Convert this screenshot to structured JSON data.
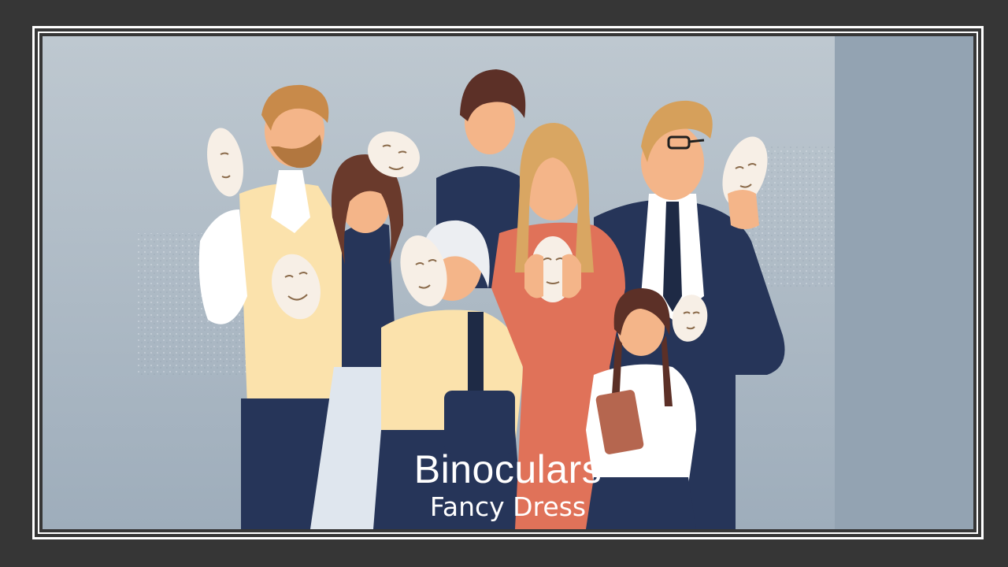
{
  "caption": {
    "title": "Binoculars",
    "subtitle": "Fancy Dress"
  },
  "colors": {
    "frame": "#363636",
    "border": "#ffffff",
    "background": "#b9c4cd",
    "background_right": "#93a3b2",
    "navy": "#263559",
    "coral": "#e07259",
    "cream": "#fbe2ac",
    "skin": "#f4b589",
    "mask": "#f7efe6",
    "blond_hair": "#c88a4a",
    "dark_hair": "#5c3027"
  }
}
